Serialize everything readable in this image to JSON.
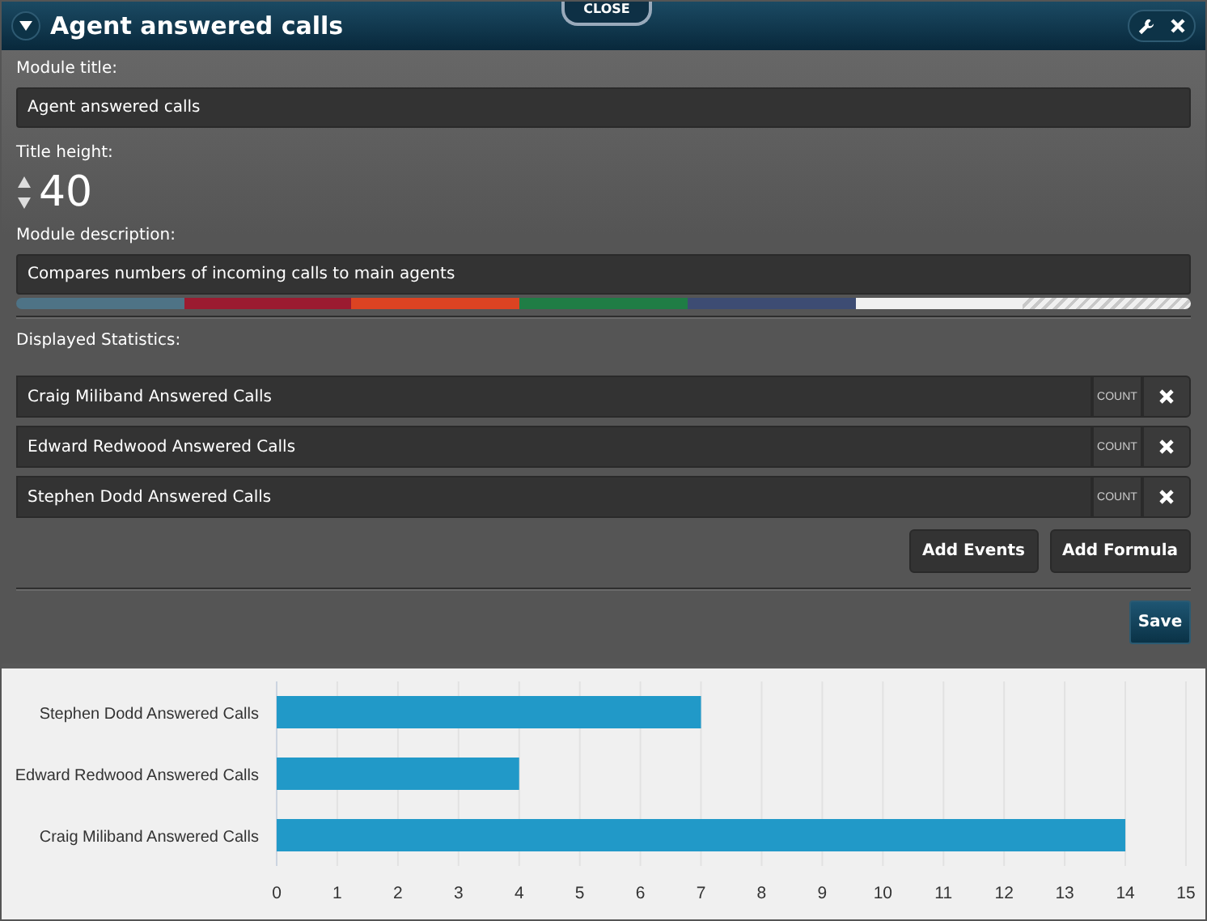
{
  "window": {
    "title": "Agent answered calls",
    "close_tab": "CLOSE"
  },
  "module_title": {
    "label": "Module title:",
    "value": "Agent answered calls"
  },
  "title_height": {
    "label": "Title height:",
    "value": "40"
  },
  "module_description": {
    "label": "Module description:",
    "value": "Compares numbers of incoming calls to main agents"
  },
  "color_swatches": [
    {
      "kind": "solid",
      "color": "#4e7386"
    },
    {
      "kind": "solid",
      "color": "#9b1b30"
    },
    {
      "kind": "solid",
      "color": "#dc4322"
    },
    {
      "kind": "solid",
      "color": "#1f7d45"
    },
    {
      "kind": "solid",
      "color": "#3d4c73"
    },
    {
      "kind": "solid",
      "color": "#f0f0f0"
    },
    {
      "kind": "pattern",
      "color": "#f0f0f0"
    }
  ],
  "displayed_statistics": {
    "label": "Displayed Statistics:",
    "items": [
      {
        "name": "Craig Miliband Answered Calls",
        "aggregate": "COUNT"
      },
      {
        "name": "Edward Redwood Answered Calls",
        "aggregate": "COUNT"
      },
      {
        "name": "Stephen Dodd Answered Calls",
        "aggregate": "COUNT"
      }
    ]
  },
  "buttons": [
    "Add Events",
    "Add Formula"
  ],
  "save_button": "Save",
  "chart": {
    "chart_data": {
      "type": "bar",
      "orientation": "horizontal",
      "categories": [
        "Stephen Dodd Answered Calls",
        "Edward Redwood Answered Calls",
        "Craig Miliband Answered Calls"
      ],
      "grid": true,
      "series": [
        {
          "color": "#2199c8",
          "values": [
            7,
            4,
            14
          ]
        }
      ],
      "xlim": [
        0,
        15
      ],
      "xticks": [
        0,
        1,
        2,
        3,
        4,
        5,
        6,
        7,
        8,
        9,
        10,
        11,
        12,
        13,
        14,
        15
      ]
    }
  }
}
